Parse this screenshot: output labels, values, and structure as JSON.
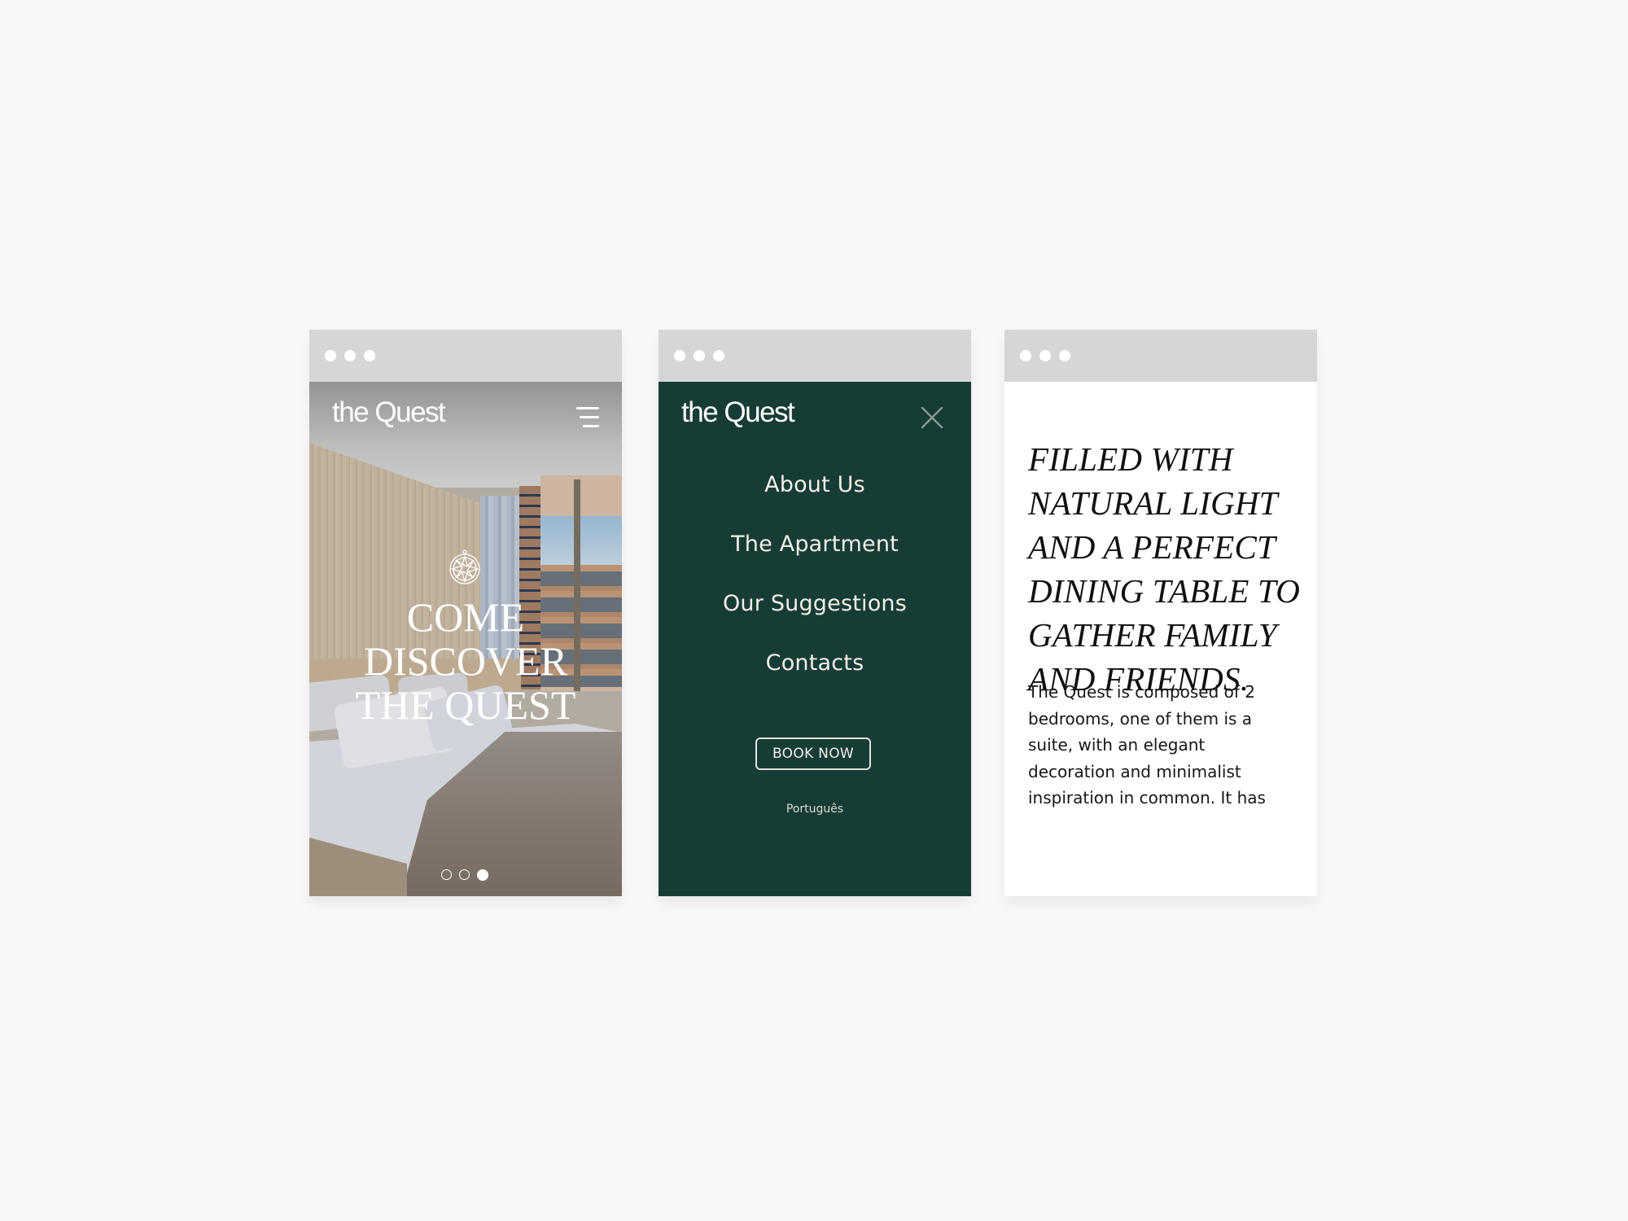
{
  "brand": {
    "logo_text": "the Quest",
    "accent_color": "#163d35",
    "background_color": "#f9f7f8",
    "browser_bar_color": "#d6d6d6"
  },
  "screens": [
    {
      "id": "home",
      "header": {
        "logo": "the Quest",
        "menu_icon": "hamburger-menu-icon"
      },
      "hero": {
        "emblem_icon": "compass-rose-icon",
        "title_lines": [
          "COME",
          "DISCOVER",
          "THE QUEST"
        ],
        "slides_total": 3,
        "active_slide": 3
      }
    },
    {
      "id": "menu",
      "header": {
        "logo": "the Quest",
        "close_icon": "close-icon"
      },
      "nav_items": [
        {
          "label": "About Us"
        },
        {
          "label": "The Apartment"
        },
        {
          "label": "Our Suggestions"
        },
        {
          "label": "Contacts"
        }
      ],
      "cta_label": "BOOK NOW",
      "language_link": "Português"
    },
    {
      "id": "apartment",
      "quote_lines": [
        "FILLED WITH",
        "NATURAL LIGHT",
        "AND A PERFECT",
        "DINING TABLE TO",
        "GATHER FAMILY",
        "AND FRIENDS."
      ],
      "body_lines": [
        "The Quest is composed of 2",
        "bedrooms, one of them is a",
        "suite, with an elegant",
        "decoration and minimalist",
        "inspiration in common. It has"
      ]
    }
  ]
}
